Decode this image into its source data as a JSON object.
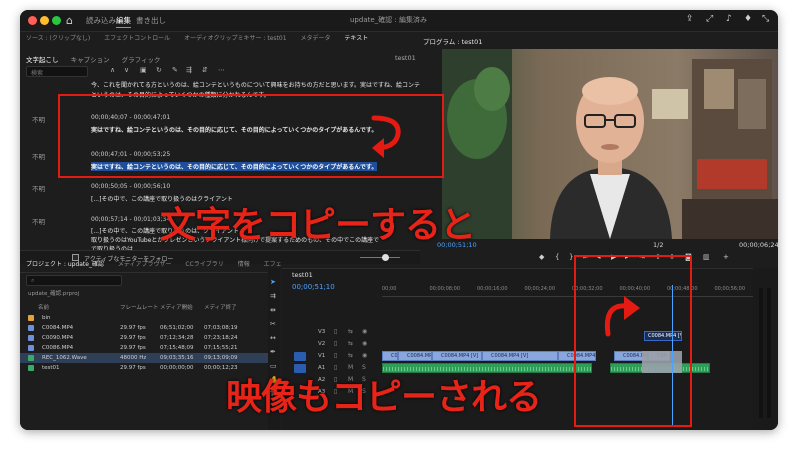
{
  "workspaces": [
    "読み込み",
    "編集",
    "書き出し"
  ],
  "active_workspace": "編集",
  "doc_title": "update_確認 : 編集済み",
  "panel_tabs_left": [
    "ソース : (クリップなし)",
    "エフェクトコントロール",
    "オーディオクリップミキサー : test01",
    "メタデータ",
    "テキスト"
  ],
  "text_panel": {
    "tabs": [
      "文字起こし",
      "キャプション",
      "グラフィック"
    ],
    "sequence": "test01",
    "search_placeholder": "検索"
  },
  "transcript": {
    "intro_line1": "今、これを聞かれてる方というのは、絵コンテというものについて興味をお持ちの方だと思います。実はですね、絵コンテ",
    "intro_line2": "というのは、その目的によっていくつかの種類に分かれるんです。",
    "speaker_label": "不明",
    "block1_time": "00;00;40;07 - 00;00;47;01",
    "block1_text": "実はですね、絵コンテというのは、その目的に応じて、その目的によっていくつかのタイプがあるんです。",
    "block2_time": "00;00;47;01 - 00;00;53;25",
    "block2_text": "実はですね、絵コンテというのは、その目的に応じて、その目的によっていくつかのタイプがあるんです。",
    "block3_time": "00;00;50;05 - 00;00;56;10",
    "block3_text": "[...]その中で、この講座で取り扱うのはクライアント",
    "block4_time": "00;00;57;14 - 00;01;03;34",
    "block4_text": "[...]その中で、この講座で取り扱うのは、クライアント",
    "block4_line2": "取り扱うのはYouTubeとかプレゼンというクライアント様向けで提案するためのもの、その中でこの講座で",
    "block4_line3": "で取り扱うのは..."
  },
  "follow_label": "アクティブなモニターをフォロー",
  "program": {
    "title": "プログラム : test01",
    "timecode": "00;00;51;10",
    "duration": "00;00;06;24",
    "scale": "1/2"
  },
  "project": {
    "tabs": [
      "プロジェクト : update_確認",
      "メディアブラウザー",
      "CCライブラリ",
      "情報",
      "エフェ"
    ],
    "file": "update_確認.prproj",
    "columns": [
      "名前",
      "フレームレート",
      "メディア開始",
      "メディア終了"
    ],
    "rows": [
      {
        "name": "bin",
        "fps": "",
        "start": "",
        "end": "",
        "color": "#e6a23a"
      },
      {
        "name": "C0084.MP4",
        "fps": "29.97 fps",
        "start": "06;51;02;00",
        "end": "07;03;08;19",
        "color": "#6f8fd8"
      },
      {
        "name": "C0090.MP4",
        "fps": "29.97 fps",
        "start": "07;12;34;28",
        "end": "07;23;18;24",
        "color": "#6f8fd8"
      },
      {
        "name": "C0086.MP4",
        "fps": "29.97 fps",
        "start": "07;15;48;09",
        "end": "07;15;55;21",
        "color": "#6f8fd8"
      },
      {
        "name": "REC_1062.Wave",
        "fps": "48000 Hz",
        "start": "09;03;35;16",
        "end": "09;13;09;09",
        "color": "#3aa96a"
      },
      {
        "name": "test01",
        "fps": "29.97 fps",
        "start": "00;00;00;00",
        "end": "00;00;12;23",
        "color": "#3aa96a"
      }
    ]
  },
  "timeline": {
    "tab": "test01",
    "timecode": "00;00;51;10",
    "ruler": [
      "00;00",
      "00;00;08;00",
      "00;00;16;00",
      "00;00;24;00",
      "00;00;32;00",
      "00;00;40;00",
      "00;00;48;00",
      "00;00;56;00",
      "00;01;04;00"
    ],
    "tracks": [
      "V3",
      "V2",
      "V1",
      "A1",
      "A2",
      "A3"
    ],
    "clips": [
      "C008",
      "C0084.MP4 [V]",
      "C0084.MP4 [V]",
      "C0084.MP4 [V]",
      "C0084.MP4 [V]",
      "C0084.MP4 [V]",
      "C00"
    ]
  },
  "annotations": {
    "copy_text": "文字をコピーすると",
    "copy_video": "映像もコピーされる"
  },
  "colors": {
    "accent": "#4aa3ff",
    "annotation_red": "#e31b12",
    "video_clip": "#8aa7dd",
    "audio_clip": "#2f9e58"
  }
}
